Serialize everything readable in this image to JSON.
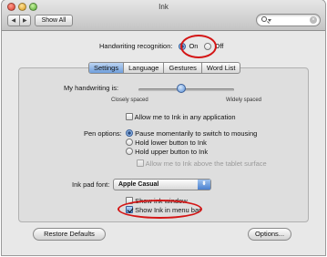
{
  "window": {
    "title": "Ink",
    "nav_back": "◀",
    "nav_forward": "▶",
    "show_all_label": "Show All",
    "search": {
      "value": "",
      "placeholder": ""
    }
  },
  "handwriting_recognition": {
    "label": "Handwriting recognition:",
    "on_label": "On",
    "off_label": "Off",
    "selected": "On"
  },
  "tabs": [
    {
      "label": "Settings",
      "active": true
    },
    {
      "label": "Language",
      "active": false
    },
    {
      "label": "Gestures",
      "active": false
    },
    {
      "label": "Word List",
      "active": false
    }
  ],
  "settings": {
    "my_handwriting_label": "My handwriting is:",
    "spacing_min_label": "Closely spaced",
    "spacing_max_label": "Widely spaced",
    "spacing_level": 0.45,
    "allow_any_app_label": "Allow me to Ink in any application",
    "allow_any_app_checked": false,
    "pen_options_label": "Pen options:",
    "pen_options": [
      {
        "label": "Pause momentarily to switch to mousing",
        "selected": true,
        "enabled": true
      },
      {
        "label": "Hold lower button to Ink",
        "selected": false,
        "enabled": true
      },
      {
        "label": "Hold upper button to Ink",
        "selected": false,
        "enabled": true
      }
    ],
    "allow_above_tablet_label": "Allow me to Ink above the tablet surface",
    "allow_above_tablet_checked": false,
    "ink_pad_font_label": "Ink pad font:",
    "ink_pad_font_value": "Apple Casual",
    "show_ink_window_label": "Show ink window",
    "show_ink_window_checked": false,
    "show_in_menu_bar_label": "Show Ink in menu bar",
    "show_in_menu_bar_checked": true
  },
  "buttons": {
    "restore_defaults": "Restore Defaults",
    "options": "Options..."
  },
  "colors": {
    "highlight_ring": "#d41515",
    "selection_blue": "#5d8fd3"
  }
}
